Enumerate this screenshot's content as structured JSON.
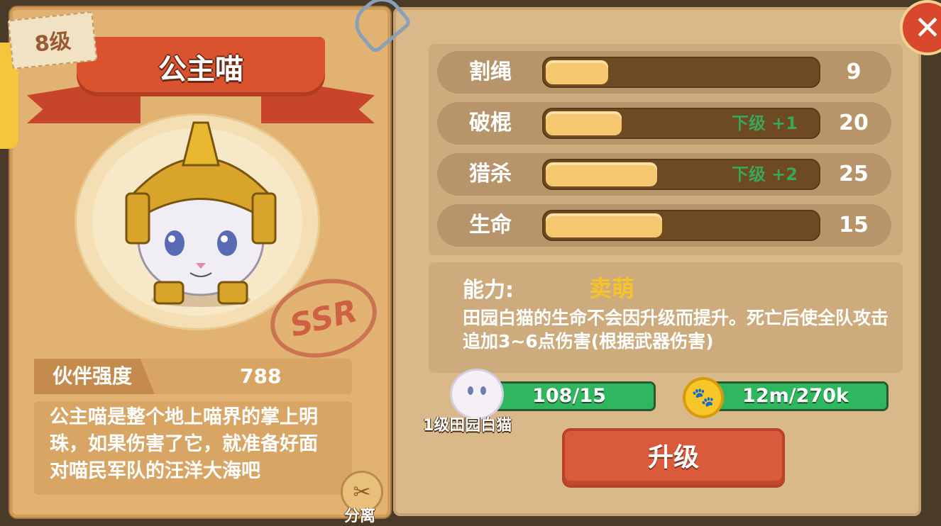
{
  "hero": {
    "level": "8级",
    "name": "公主喵",
    "rarity": "SSR",
    "power_label": "伙伴强度",
    "power_value": "788",
    "description": "公主喵是整个地上喵界的掌上明珠，如果伤害了它，就准备好面对喵民军队的汪洋大海吧",
    "split_label": "分离"
  },
  "stats": [
    {
      "name": "割绳",
      "value": "9",
      "fill": 0.23,
      "bonus": ""
    },
    {
      "name": "破棍",
      "value": "20",
      "fill": 0.28,
      "bonus": "下级 +1"
    },
    {
      "name": "猎杀",
      "value": "25",
      "fill": 0.41,
      "bonus": "下级 +2"
    },
    {
      "name": "生命",
      "value": "15",
      "fill": 0.43,
      "bonus": ""
    }
  ],
  "ability": {
    "label": "能力:",
    "name": "卖萌",
    "description": "田园白猫的生命不会因升级而提升。死亡后使全队攻击追加3~6点伤害(根据武器伤害)"
  },
  "resources": {
    "material_count": "108/15",
    "material_name": "1级田园白猫",
    "gold": "12m/270k"
  },
  "actions": {
    "upgrade_label": "升级",
    "close_label": "✕"
  },
  "colors": {
    "accent_red": "#d9532f",
    "resource_green": "#2fb760",
    "bonus_green": "#3aa65a",
    "ability_gold": "#f5c32a"
  }
}
